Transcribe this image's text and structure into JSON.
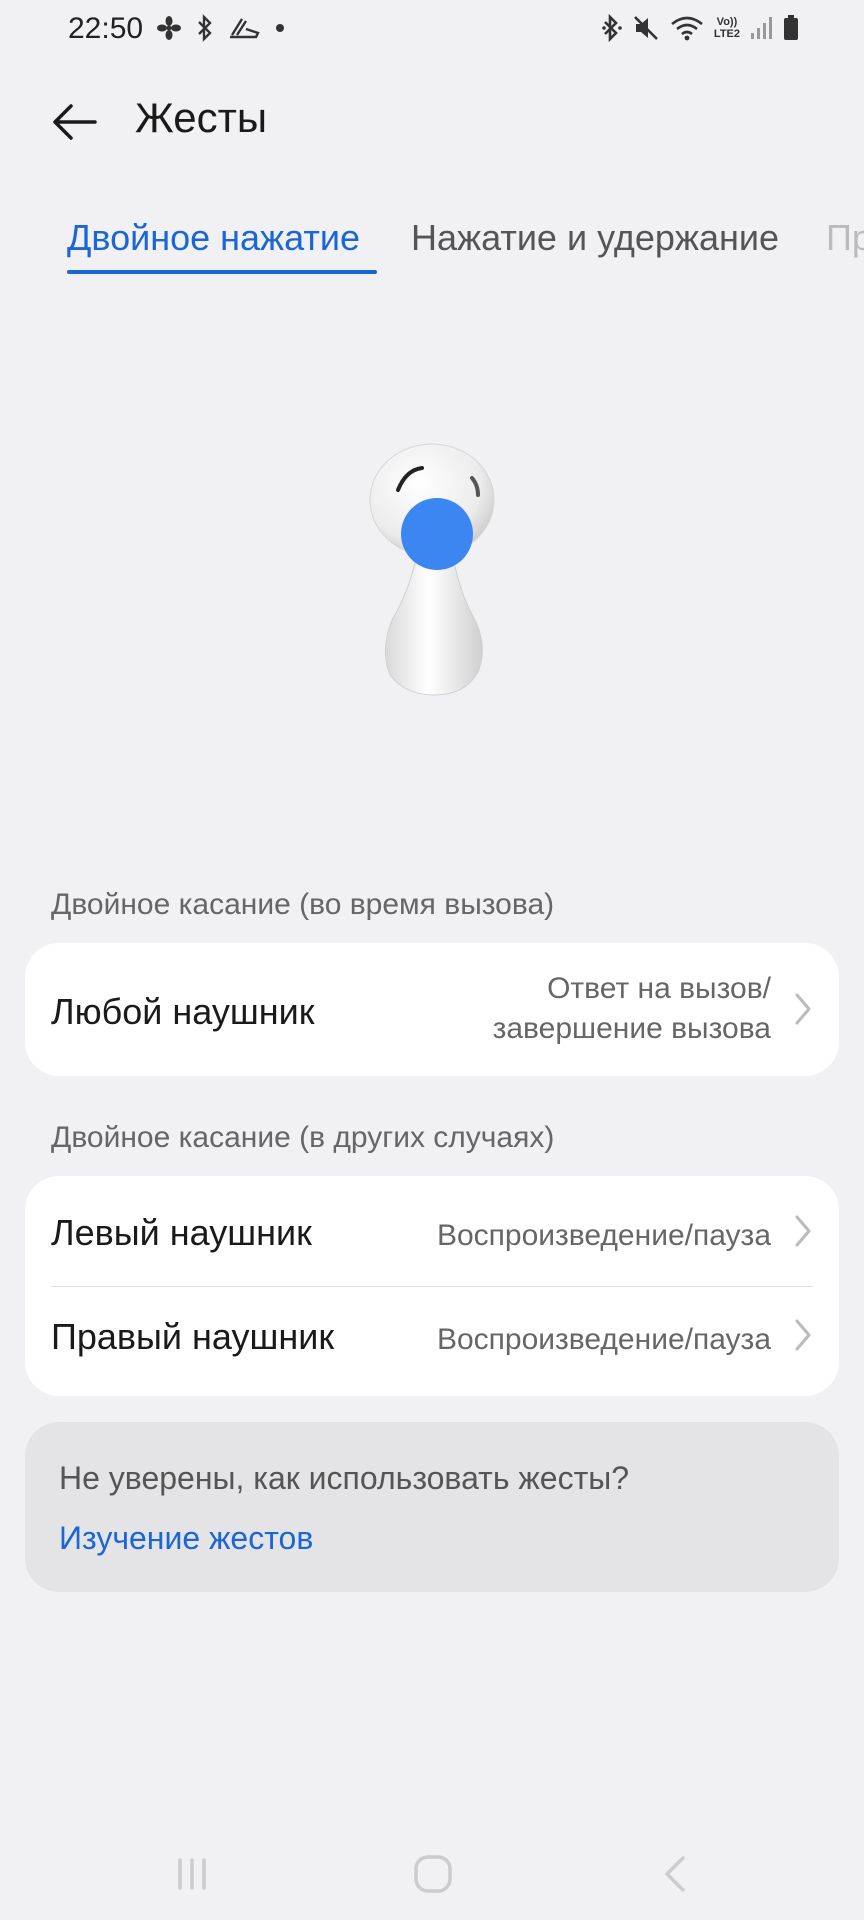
{
  "status_bar": {
    "time": "22:50",
    "left_icons": [
      "fan-icon",
      "bluetooth-icon",
      "shoe-icon",
      "dot-icon"
    ],
    "right_icons": [
      "bluetooth-icon",
      "mute-icon",
      "wifi-icon",
      "volte-lte2-icon",
      "signal-icon",
      "battery-icon"
    ],
    "volte_text_top": "Vo))",
    "volte_text_bottom": "LTE2"
  },
  "header": {
    "title": "Жесты",
    "back_icon": "arrow-left-icon"
  },
  "tabs": [
    {
      "label": "Двойное нажатие",
      "active": true
    },
    {
      "label": "Нажатие и удержание",
      "active": false
    },
    {
      "label": "Пр",
      "active": false
    }
  ],
  "sections": [
    {
      "header": "Двойное касание (во время вызова)",
      "rows": [
        {
          "label": "Любой наушник",
          "value_line1": "Ответ на вызов/",
          "value_line2": "завершение вызова"
        }
      ]
    },
    {
      "header": "Двойное касание (в других случаях)",
      "rows": [
        {
          "label": "Левый наушник",
          "value": "Воспроизведение/пауза"
        },
        {
          "label": "Правый наушник",
          "value": "Воспроизведение/пауза"
        }
      ]
    }
  ],
  "help": {
    "question": "Не уверены, как использовать жесты?",
    "link": "Изучение жестов"
  },
  "colors": {
    "accent": "#1a66d6",
    "background": "#f1f1f3",
    "card": "#ffffff",
    "tap_indicator": "#3b86f0"
  }
}
